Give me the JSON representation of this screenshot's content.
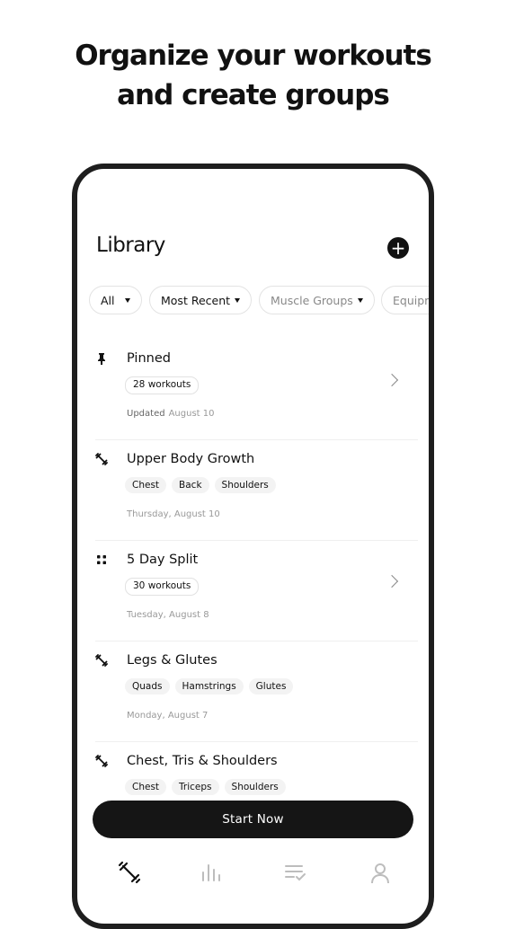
{
  "headline": {
    "line1": "Organize your workouts",
    "line2": "and create groups"
  },
  "library": {
    "title": "Library",
    "add_icon": "plus-circle-icon"
  },
  "filters": [
    {
      "label": "All"
    },
    {
      "label": "Most Recent"
    },
    {
      "label": "Muscle Groups"
    },
    {
      "label": "Equipm"
    }
  ],
  "rows": [
    {
      "title": "Pinned",
      "icon": "pin-icon",
      "tags": [
        "28 workouts"
      ],
      "meta_strong": "Updated",
      "meta": "August 10",
      "chevron": true
    },
    {
      "title": "Upper Body Growth",
      "icon": "dumbbell-icon",
      "tags": [
        "Chest",
        "Back",
        "Shoulders"
      ],
      "meta_strong": "",
      "meta": "Thursday, August 10",
      "chevron": false
    },
    {
      "title": "5 Day Split",
      "icon": "grid-dots-icon",
      "tags": [
        "30 workouts"
      ],
      "meta_strong": "",
      "meta": "Tuesday, August 8",
      "chevron": true
    },
    {
      "title": "Legs & Glutes",
      "icon": "dumbbell-icon",
      "tags": [
        "Quads",
        "Hamstrings",
        "Glutes"
      ],
      "meta_strong": "",
      "meta": "Monday, August 7",
      "chevron": false
    },
    {
      "title": "Chest, Tris & Shoulders",
      "icon": "dumbbell-icon",
      "tags": [
        "Chest",
        "Triceps",
        "Shoulders"
      ],
      "meta_strong": "",
      "meta": "",
      "chevron": false
    }
  ],
  "start_button": {
    "label": "Start Now"
  },
  "tabbar": [
    {
      "icon": "dumbbell-icon",
      "active": true
    },
    {
      "icon": "bar-chart-icon",
      "active": false
    },
    {
      "icon": "list-check-icon",
      "active": false
    },
    {
      "icon": "profile-icon",
      "active": false
    }
  ],
  "colors": {
    "accent": "#151515",
    "muted_text": "#999999",
    "chip_border": "#e3e3e3",
    "tag_bg": "#f3f3f3"
  }
}
